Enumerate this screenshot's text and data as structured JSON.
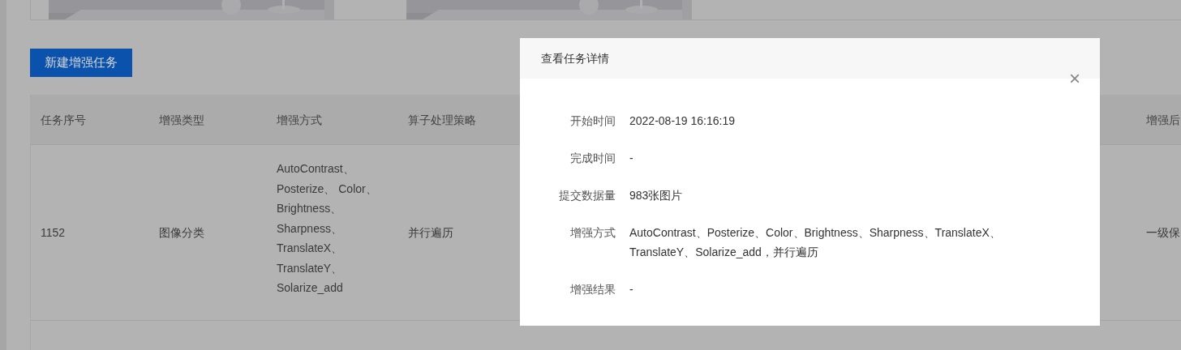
{
  "new_task_button": "新建增强任务",
  "table": {
    "columns": [
      "任务序号",
      "增强类型",
      "增强方式",
      "算子处理策略",
      "增强后"
    ],
    "rows": [
      {
        "cells": [
          "1152",
          "图像分类",
          [
            "AutoContrast、",
            "Posterize、 Color、",
            "Brightness、",
            "Sharpness、",
            "TranslateX、",
            "TranslateY、",
            "Solarize_add"
          ],
          "并行遍历",
          "一级保"
        ]
      }
    ]
  },
  "dialog": {
    "title": "查看任务详情",
    "close": "×",
    "fields": [
      {
        "label": "开始时间",
        "value": "2022-08-19 16:16:19"
      },
      {
        "label": "完成时间",
        "value": "-"
      },
      {
        "label": "提交数据量",
        "value": "983张图片"
      },
      {
        "label": "增强方式",
        "value": "AutoContrast、Posterize、Color、Brightness、Sharpness、TranslateX、TranslateY、Solarize_add，并行遍历"
      },
      {
        "label": "增强结果",
        "value": "-"
      }
    ]
  }
}
